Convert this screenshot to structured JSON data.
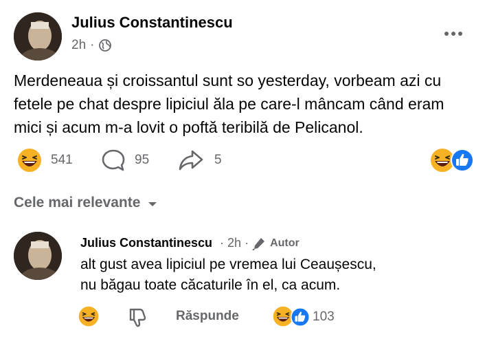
{
  "post": {
    "author": "Julius Constantinescu",
    "time": "2h",
    "separator": "·",
    "privacy_icon": "globe-icon",
    "menu_icon": "more-options-icon",
    "text": "Merdeneaua și croissantul sunt so yesterday, vorbeam azi cu\nfetele pe chat despre lipiciul ăla pe care-l mâncam când eram\nmici și acum m-a lovit o poftă teribilă  de Pelicanol.",
    "reaction_count": "541",
    "comment_count": "95",
    "share_count": "5"
  },
  "comments_section": {
    "sort_label": "Cele mai relevante"
  },
  "comment": {
    "author": "Julius Constantinescu",
    "separator": "·",
    "time": "2h",
    "badge": "Autor",
    "text": "alt gust avea lipiciul pe vremea lui Ceaușescu,\nnu băgau toate căcaturile în el, ca acum.",
    "reply_label": "Răspunde",
    "reaction_count": "103"
  },
  "colors": {
    "secondary_text": "#65676b",
    "primary_text": "#050505",
    "like_blue": "#1877f2",
    "emoji_yellow": "#f7b125"
  }
}
